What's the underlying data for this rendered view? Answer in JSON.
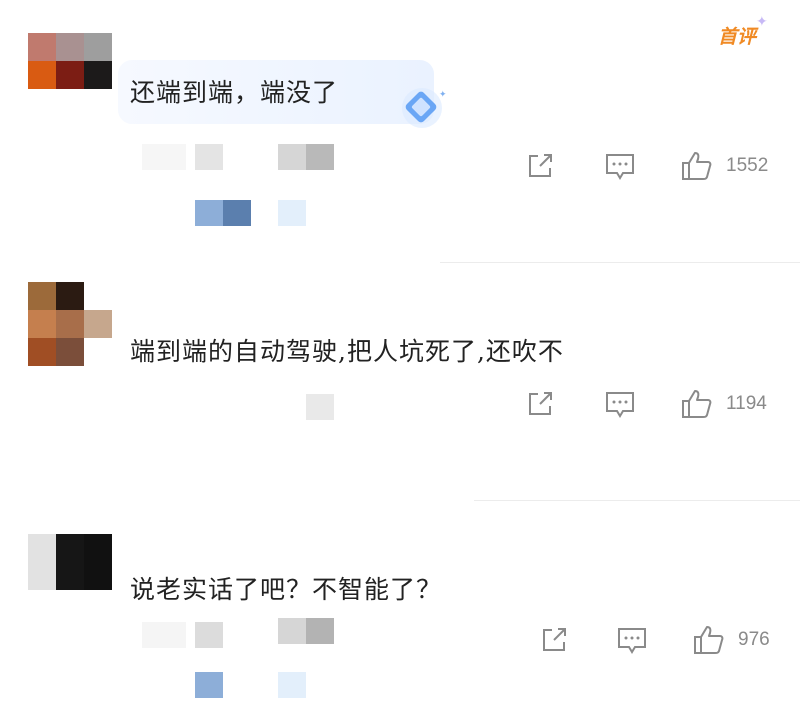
{
  "comments": [
    {
      "text": "还端到端，端没了",
      "badge": "首评",
      "likes": "1552",
      "avatar_colors": [
        "#c07a6e",
        "#a99191",
        "#9e9e9e",
        "#d95b12",
        "#7c1d14",
        "#1c1a1a"
      ]
    },
    {
      "text": "端到端的自动驾驶,把人坑死了,还吹不",
      "likes": "1194",
      "avatar_colors": [
        "#9c6a3a",
        "#2b1b12",
        "#ffffff",
        "#c57f4e",
        "#a86e4a",
        "#c6a78d",
        "#a04e24",
        "#7b4e3a",
        "#ffffff"
      ]
    },
    {
      "text": "说老实话了吧？不智能了？",
      "likes": "976",
      "avatar_colors": [
        "#e2e2e2",
        "#161616",
        "#111111"
      ]
    }
  ],
  "icons": {
    "share": "share-icon",
    "reply": "comment-icon",
    "like": "thumbs-up-icon"
  },
  "colors": {
    "badge": "#f08a24",
    "icon_gray": "#8a8a8a",
    "text": "#222222"
  }
}
